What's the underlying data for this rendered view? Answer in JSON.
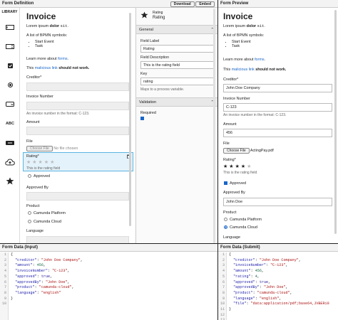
{
  "definition": {
    "title": "Form Definition",
    "download_label": "Download",
    "embed_label": "Embed",
    "library_label": "LIBRARY",
    "library_text_icon_label": "ABC",
    "canvas": {
      "heading": "Invoice",
      "lorem_prefix": "Lorem ipsum",
      "lorem_bold": "dolor",
      "lorem_code": "sit",
      "lorem_suffix": ".",
      "bpmn_intro": "A list of BPMN symbols:",
      "bpmn_items": [
        "Start Event",
        "Task"
      ],
      "learn_prefix": "Learn more about",
      "learn_link": "forms",
      "learn_suffix": ".",
      "malicious_prefix": "This",
      "malicious_link": "malicious link",
      "malicious_suffix": "should not work.",
      "creditor_label": "Creditor*",
      "invoice_label": "Invoice Number",
      "invoice_desc": "An invoice number in the format: C-123.",
      "amount_label": "Amount",
      "file_label": "File",
      "file_button": "Choose File",
      "file_status": "No file chosen",
      "rating_label": "Rating*",
      "rating_desc": "This is the rating field",
      "approved_label": "Approved",
      "approved_by_label": "Approved By",
      "product_label": "Product",
      "product_options": [
        "Camunda Platform",
        "Camunda Cloud"
      ],
      "language_label": "Language"
    },
    "properties": {
      "component_title": "Rating",
      "component_subtitle": "Rating",
      "general_label": "General",
      "field_label_label": "Field Label",
      "field_label_value": "Rating",
      "field_desc_label": "Field Description",
      "field_desc_value": "This is the rating field",
      "key_label": "Key",
      "key_value": "rating",
      "key_desc": "Maps to a process variable.",
      "validation_label": "Validation",
      "required_label": "Required"
    }
  },
  "preview": {
    "title": "Form Preview",
    "heading": "Invoice",
    "lorem_prefix": "Lorem ipsum",
    "lorem_bold": "dolor",
    "lorem_code": "sit",
    "lorem_suffix": ".",
    "bpmn_intro": "A list of BPMN symbols:",
    "bpmn_items": [
      "Start Event",
      "Task"
    ],
    "learn_prefix": "Learn more about",
    "learn_link": "forms",
    "learn_suffix": ".",
    "malicious_prefix": "This",
    "malicious_link": "malicious link",
    "malicious_suffix": "should not work.",
    "creditor_label": "Creditor*",
    "creditor_value": "John Doe Company",
    "invoice_label": "Invoice Number",
    "invoice_value": "C-123",
    "invoice_desc": "An invoice number in the format: C-123.",
    "amount_label": "Amount",
    "amount_value": "456",
    "file_label": "File",
    "file_button": "Choose File",
    "file_status": "ActingPay.pdf",
    "rating_label": "Rating*",
    "rating_value": 4,
    "rating_max": 5,
    "rating_desc": "This is the rating field",
    "approved_label": "Approved",
    "approved_by_label": "Approved By",
    "approved_by_value": "John Doe",
    "product_label": "Product",
    "product_options": [
      "Camunda Platform",
      "Camunda Cloud"
    ],
    "language_label": "Language"
  },
  "data_input": {
    "title": "Form Data (Input)",
    "line_numbers": [
      "1",
      "2",
      "3",
      "4",
      "5",
      "6",
      "7",
      "8",
      "9",
      "10"
    ],
    "lines": [
      "{",
      "  \"creditor\": \"John Doe Company\",",
      "  \"amount\": 456,",
      "  \"invoiceNumber\": \"C-123\",",
      "  \"approved\": true,",
      "  \"approvedBy\": \"John Doe\",",
      "  \"product\": \"camunda-cloud\",",
      "  \"language\": \"english\"",
      "}",
      ""
    ]
  },
  "data_submit": {
    "title": "Form Data (Submit)",
    "line_numbers": [
      "1",
      "2",
      "3",
      "4",
      "5",
      "6",
      "7",
      "8",
      "9",
      "10",
      "11",
      "12",
      "13"
    ],
    "lines": [
      "{",
      "  \"creditor\": \"John Doe Company\",",
      "  \"invoiceNumber\": \"C-123\",",
      "  \"amount\": 456,",
      "  \"rating\": 4,",
      "  \"approved\": true,",
      "  \"approvedBy\": \"John Doe\",",
      "  \"product\": \"camunda-cloud\",",
      "  \"language\": \"english\",",
      "  \"file\": \"data:application/pdf;base64,JVBERi0",
      "}",
      "",
      ""
    ]
  },
  "colors": {
    "accent": "#1a66c9",
    "selected_bg": "#e4f3fb",
    "selected_border": "#5bb3e0"
  }
}
